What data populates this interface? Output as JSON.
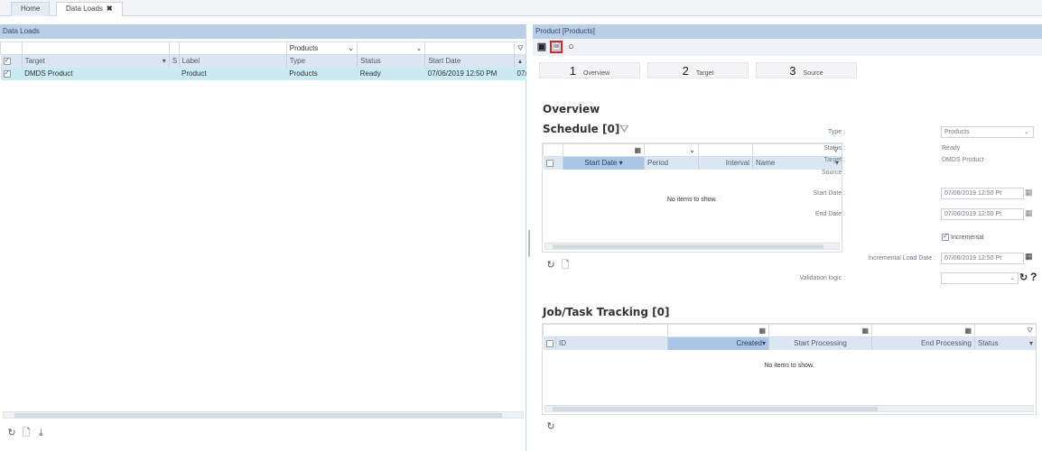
{
  "tabs": [
    {
      "label": "Home",
      "closable": false
    },
    {
      "label": "Data Loads",
      "closable": true
    }
  ],
  "left": {
    "title": "Data Loads",
    "filters": {
      "type": "Products"
    },
    "columns": {
      "target": "Target",
      "s": "S",
      "label": "Label",
      "type": "Type",
      "status": "Status",
      "start_date": "Start Date"
    },
    "rows": [
      {
        "target": "DMDS Product",
        "label": "Product",
        "type": "Products",
        "status": "Ready",
        "start_date": "07/06/2019 12:50 PM",
        "extra": "07/"
      }
    ]
  },
  "right": {
    "title": "Product [Products]",
    "steps": [
      {
        "num": "1",
        "label": "Overview"
      },
      {
        "num": "2",
        "label": "Target"
      },
      {
        "num": "3",
        "label": "Source"
      }
    ],
    "overview_title": "Overview",
    "schedule": {
      "title": "Schedule [0]",
      "columns": {
        "start_date": "Start Date",
        "period": "Period",
        "interval": "Interval",
        "name": "Name"
      },
      "empty": "No items to show."
    },
    "fields": {
      "type_label": "Type :",
      "type_value": "Products",
      "status_label": "Status :",
      "status_value": "Ready",
      "target_label": "Target :",
      "target_value": "DMDS Product",
      "source_label": "Source :",
      "start_label": "Start Date :",
      "start_value": "07/06/2019 12:50 Pt",
      "end_label": "End Date :",
      "end_value": "07/06/2019 12:50 Pt",
      "incremental_label": "Incremental",
      "inc_load_label": "Incremental Load Date :",
      "inc_load_value": "07/06/2019 12:50 Pt",
      "validation_label": "Validation logic :"
    },
    "tracking": {
      "title": "Job/Task Tracking [0]",
      "columns": {
        "id": "ID",
        "created": "Created",
        "start_processing": "Start Processing",
        "end_processing": "End Processing",
        "status": "Status"
      },
      "empty": "No items to show."
    }
  },
  "icons": [
    "save-icon",
    "new-document-icon",
    "circle-icon",
    "refresh-icon",
    "download-icon",
    "calendar-icon",
    "filter-icon",
    "help-icon"
  ]
}
